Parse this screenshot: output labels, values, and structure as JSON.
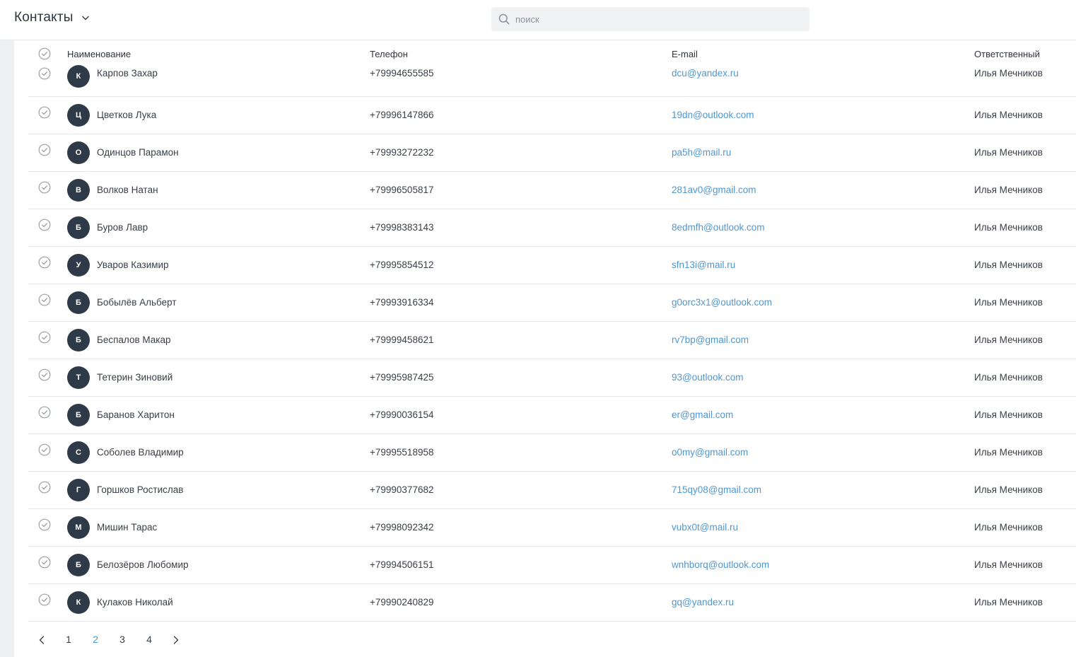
{
  "header": {
    "title": "Контакты",
    "search_placeholder": "поиск"
  },
  "table": {
    "columns": {
      "name": "Наименование",
      "phone": "Телефон",
      "email": "E-mail",
      "owner": "Ответственный"
    },
    "rows": [
      {
        "initial": "К",
        "name": "Карпов Захар",
        "phone": "+79994655585",
        "email": "dcu@yandex.ru",
        "owner": "Илья Мечников"
      },
      {
        "initial": "Ц",
        "name": "Цветков Лука",
        "phone": "+79996147866",
        "email": "19dn@outlook.com",
        "owner": "Илья Мечников"
      },
      {
        "initial": "О",
        "name": "Одинцов Парамон",
        "phone": "+79993272232",
        "email": "pa5h@mail.ru",
        "owner": "Илья Мечников"
      },
      {
        "initial": "В",
        "name": "Волков Натан",
        "phone": "+79996505817",
        "email": "281av0@gmail.com",
        "owner": "Илья Мечников"
      },
      {
        "initial": "Б",
        "name": "Буров Лавр",
        "phone": "+79998383143",
        "email": "8edmfh@outlook.com",
        "owner": "Илья Мечников"
      },
      {
        "initial": "У",
        "name": "Уваров Казимир",
        "phone": "+79995854512",
        "email": "sfn13i@mail.ru",
        "owner": "Илья Мечников"
      },
      {
        "initial": "Б",
        "name": "Бобылёв Альберт",
        "phone": "+79993916334",
        "email": "g0orc3x1@outlook.com",
        "owner": "Илья Мечников"
      },
      {
        "initial": "Б",
        "name": "Беспалов Макар",
        "phone": "+79999458621",
        "email": "rv7bp@gmail.com",
        "owner": "Илья Мечников"
      },
      {
        "initial": "Т",
        "name": "Тетерин Зиновий",
        "phone": "+79995987425",
        "email": "93@outlook.com",
        "owner": "Илья Мечников"
      },
      {
        "initial": "Б",
        "name": "Баранов Харитон",
        "phone": "+79990036154",
        "email": "er@gmail.com",
        "owner": "Илья Мечников"
      },
      {
        "initial": "С",
        "name": "Соболев Владимир",
        "phone": "+79995518958",
        "email": "o0my@gmail.com",
        "owner": "Илья Мечников"
      },
      {
        "initial": "Г",
        "name": "Горшков Ростислав",
        "phone": "+79990377682",
        "email": "715qy08@gmail.com",
        "owner": "Илья Мечников"
      },
      {
        "initial": "М",
        "name": "Мишин Тарас",
        "phone": "+79998092342",
        "email": "vubx0t@mail.ru",
        "owner": "Илья Мечников"
      },
      {
        "initial": "Б",
        "name": "Белозёров Любомир",
        "phone": "+79994506151",
        "email": "wnhborq@outlook.com",
        "owner": "Илья Мечников"
      },
      {
        "initial": "К",
        "name": "Кулаков Николай",
        "phone": "+79990240829",
        "email": "gq@yandex.ru",
        "owner": "Илья Мечников"
      }
    ]
  },
  "pagination": {
    "pages": [
      "1",
      "2",
      "3",
      "4"
    ],
    "current": "2"
  },
  "icons": {
    "chevron": "chevron-down-icon",
    "search": "search-icon",
    "check": "check-circle-icon",
    "prev": "chevron-left-icon",
    "next": "chevron-right-icon"
  },
  "colors": {
    "accent": "#4f97d1",
    "avatar_bg": "#2f3a48",
    "search_bg": "#f0f2f4",
    "divider": "#e6e8eb"
  }
}
